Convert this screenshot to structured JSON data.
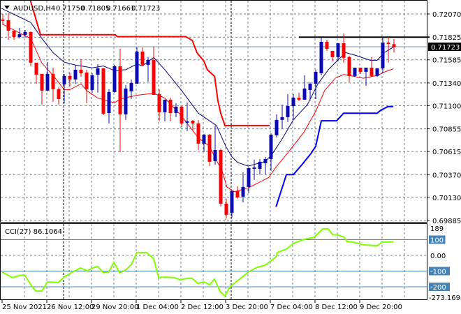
{
  "header": {
    "symbol": "AUDUSD,H4",
    "open": "0.71750",
    "high": "0.71805",
    "low": "0.71661",
    "close": "0.71723"
  },
  "colors": {
    "bull": "#0a0ab4",
    "bear": "#ff0000",
    "ma_fast": "#000080",
    "ma_slow": "#ff0000",
    "stop_up": "#ff0000",
    "stop_down": "#0000ff",
    "cci": "#7fff00",
    "level": "#4682b4",
    "grid": "#708090"
  },
  "chart_data": [
    {
      "type": "candlestick",
      "title": "AUDUSD,H4",
      "ylim": [
        0.69885,
        0.7207
      ],
      "y_ticks": [
        "0.72070",
        "0.71825",
        "0.71585",
        "0.71340",
        "0.71100",
        "0.70855",
        "0.70615",
        "0.70370",
        "0.70130",
        "0.69885"
      ],
      "current_price": "0.71723",
      "resistance_level": 0.71825,
      "x_labels": [
        "25 Nov 2021",
        "26 Nov 12:00",
        "29 Nov 20:00",
        "1 Dec 04:00",
        "2 Dec 12:00",
        "3 Dec 20:00",
        "7 Dec 04:00",
        "8 Dec 12:00",
        "9 Dec 20:00"
      ],
      "ohlc": [
        [
          0.72011,
          0.7207,
          0.71952,
          0.71997
        ],
        [
          0.72004,
          0.72078,
          0.71797,
          0.71893
        ],
        [
          0.71893,
          0.71893,
          0.71797,
          0.71827
        ],
        [
          0.71827,
          0.71923,
          0.71812,
          0.71856
        ],
        [
          0.71849,
          0.71901,
          0.71819,
          0.71879
        ],
        [
          0.71879,
          0.71886,
          0.71517,
          0.71554
        ],
        [
          0.71554,
          0.71554,
          0.71332,
          0.71428
        ],
        [
          0.71436,
          0.71436,
          0.71111,
          0.71259
        ],
        [
          0.71259,
          0.71561,
          0.71251,
          0.71436
        ],
        [
          0.71436,
          0.71502,
          0.71141,
          0.71274
        ],
        [
          0.71274,
          0.71296,
          0.71111,
          0.7117
        ],
        [
          0.71325,
          0.71436,
          0.71126,
          0.71414
        ],
        [
          0.71414,
          0.7145,
          0.71303,
          0.71377
        ],
        [
          0.71377,
          0.71532,
          0.71332,
          0.7148
        ],
        [
          0.7148,
          0.71591,
          0.71406,
          0.71443
        ],
        [
          0.7145,
          0.7148,
          0.71126,
          0.71274
        ],
        [
          0.71266,
          0.71443,
          0.71237,
          0.71421
        ],
        [
          0.71428,
          0.71539,
          0.71237,
          0.71495
        ],
        [
          0.71495,
          0.71495,
          0.71,
          0.71015
        ],
        [
          0.71022,
          0.71274,
          0.70912,
          0.71244
        ],
        [
          0.71244,
          0.71532,
          0.71237,
          0.71517
        ],
        [
          0.71517,
          0.71701,
          0.70609,
          0.71008
        ],
        [
          0.71008,
          0.71318,
          0.70949,
          0.71281
        ],
        [
          0.71251,
          0.71377,
          0.7117,
          0.7134
        ],
        [
          0.71332,
          0.71716,
          0.71332,
          0.71672
        ],
        [
          0.71672,
          0.71716,
          0.71517,
          0.71532
        ],
        [
          0.71532,
          0.71613,
          0.71355,
          0.71583
        ],
        [
          0.71583,
          0.71724,
          0.71214,
          0.71214
        ],
        [
          0.71222,
          0.71274,
          0.70934,
          0.7103
        ],
        [
          0.7103,
          0.71163,
          0.70934,
          0.71163
        ],
        [
          0.71163,
          0.71185,
          0.70934,
          0.71022
        ],
        [
          0.71022,
          0.71126,
          0.70978,
          0.71089
        ],
        [
          0.71089,
          0.71096,
          0.70875,
          0.70912
        ],
        [
          0.70919,
          0.71133,
          0.70831,
          0.70934
        ],
        [
          0.70941,
          0.70949,
          0.70838,
          0.70912
        ],
        [
          0.70912,
          0.70949,
          0.70631,
          0.70698
        ],
        [
          0.70698,
          0.70801,
          0.70609,
          0.70793
        ],
        [
          0.70793,
          0.70801,
          0.70462,
          0.70506
        ],
        [
          0.70513,
          0.7089,
          0.70476,
          0.70631
        ],
        [
          0.70631,
          0.70646,
          0.70034,
          0.70063
        ],
        [
          0.70063,
          0.70115,
          0.69908,
          0.69945
        ],
        [
          0.69967,
          0.70196,
          0.69916,
          0.70196
        ],
        [
          0.70196,
          0.70248,
          0.70115,
          0.7013
        ],
        [
          0.70137,
          0.70395,
          0.70078,
          0.7024
        ],
        [
          0.7024,
          0.70447,
          0.70174,
          0.7044
        ],
        [
          0.70432,
          0.70528,
          0.70314,
          0.70447
        ],
        [
          0.70432,
          0.70535,
          0.70373,
          0.70506
        ],
        [
          0.70491,
          0.70557,
          0.70373,
          0.70535
        ],
        [
          0.70535,
          0.70808,
          0.7041,
          0.70793
        ],
        [
          0.70786,
          0.71008,
          0.70764,
          0.70949
        ],
        [
          0.70949,
          0.71111,
          0.70853,
          0.70978
        ],
        [
          0.70978,
          0.71222,
          0.70927,
          0.71096
        ],
        [
          0.71096,
          0.71222,
          0.70963,
          0.71185
        ],
        [
          0.71185,
          0.71237,
          0.71148,
          0.71163
        ],
        [
          0.71163,
          0.71421,
          0.71163,
          0.71281
        ],
        [
          0.71266,
          0.71347,
          0.71155,
          0.71332
        ],
        [
          0.71332,
          0.7148,
          0.7117,
          0.71458
        ],
        [
          0.71443,
          0.71827,
          0.71421,
          0.71775
        ],
        [
          0.71775,
          0.71797,
          0.71679,
          0.71701
        ],
        [
          0.71679,
          0.71679,
          0.71569,
          0.71613
        ],
        [
          0.71613,
          0.7176,
          0.71569,
          0.7176
        ],
        [
          0.7176,
          0.71864,
          0.71554,
          0.71606
        ],
        [
          0.71613,
          0.71628,
          0.71347,
          0.71414
        ],
        [
          0.71414,
          0.71502,
          0.71406,
          0.71502
        ],
        [
          0.71502,
          0.71502,
          0.71436,
          0.71458
        ],
        [
          0.71458,
          0.71502,
          0.7131,
          0.71502
        ],
        [
          0.71502,
          0.71613,
          0.71406,
          0.71414
        ],
        [
          0.71414,
          0.71495,
          0.71406,
          0.71495
        ],
        [
          0.71495,
          0.71827,
          0.71443,
          0.71768
        ],
        [
          0.71768,
          0.71827,
          0.71554,
          0.71753
        ],
        [
          0.7175,
          0.71805,
          0.71661,
          0.71723
        ]
      ],
      "lines": [
        {
          "name": "ma_fast",
          "points": [
            [
              -0.25,
              0.7213
            ],
            [
              5,
              0.7198
            ],
            [
              7,
              0.7181
            ],
            [
              9,
              0.7166
            ],
            [
              11,
              0.7156
            ],
            [
              13,
              0.7153
            ],
            [
              16,
              0.715
            ],
            [
              18,
              0.7152
            ],
            [
              20,
              0.7147
            ],
            [
              22,
              0.7148
            ],
            [
              24,
              0.7154
            ],
            [
              25,
              0.7152
            ],
            [
              27,
              0.7161
            ],
            [
              29,
              0.7148
            ],
            [
              32,
              0.7126
            ],
            [
              35,
              0.7102
            ],
            [
              38.25,
              0.7089
            ],
            [
              39.9,
              0.7067
            ],
            [
              41,
              0.7056
            ],
            [
              42,
              0.705
            ],
            [
              43.9,
              0.7046
            ],
            [
              47,
              0.7051
            ],
            [
              48.25,
              0.7059
            ],
            [
              50.1,
              0.7076
            ],
            [
              52,
              0.7095
            ],
            [
              54.5,
              0.7111
            ],
            [
              56.4,
              0.7133
            ],
            [
              58.25,
              0.7148
            ],
            [
              60.1,
              0.7159
            ],
            [
              61.4,
              0.7166
            ],
            [
              63.25,
              0.7163
            ],
            [
              65.75,
              0.7158
            ],
            [
              67,
              0.7158
            ],
            [
              68.25,
              0.7166
            ],
            [
              69.9,
              0.7172
            ]
          ]
        },
        {
          "name": "ma_slow",
          "points": [
            [
              0,
              0.7196
            ],
            [
              5,
              0.7181
            ],
            [
              7,
              0.7155
            ],
            [
              9,
              0.7142
            ],
            [
              11,
              0.7127
            ],
            [
              12,
              0.7127
            ],
            [
              14,
              0.7133
            ],
            [
              15,
              0.7126
            ],
            [
              17,
              0.7118
            ],
            [
              20,
              0.7113
            ],
            [
              21,
              0.7117
            ],
            [
              24,
              0.7121
            ],
            [
              27,
              0.7123
            ],
            [
              29,
              0.7118
            ],
            [
              32,
              0.7099
            ],
            [
              35,
              0.7076
            ],
            [
              37,
              0.7067
            ],
            [
              38.25,
              0.7052
            ],
            [
              39.25,
              0.7041
            ],
            [
              40.1,
              0.7024
            ],
            [
              41.4,
              0.7019
            ],
            [
              43.9,
              0.7023
            ],
            [
              47.6,
              0.7034
            ],
            [
              48.9,
              0.7045
            ],
            [
              51.4,
              0.7063
            ],
            [
              53.9,
              0.7082
            ],
            [
              56,
              0.7104
            ],
            [
              57.6,
              0.7126
            ],
            [
              59.5,
              0.7139
            ],
            [
              61,
              0.7143
            ],
            [
              62,
              0.7142
            ],
            [
              64.5,
              0.7139
            ],
            [
              67,
              0.7142
            ],
            [
              68.5,
              0.7146
            ],
            [
              69.9,
              0.7149
            ]
          ]
        },
        {
          "name": "stop_up",
          "points": [
            [
              4.9,
              0.7222
            ],
            [
              6.75,
              0.7185
            ],
            [
              20.1,
              0.7185
            ],
            [
              20.5,
              0.7183
            ],
            [
              32.75,
              0.7183
            ],
            [
              33.9,
              0.7179
            ],
            [
              34.75,
              0.7166
            ],
            [
              36,
              0.7157
            ],
            [
              36.6,
              0.7148
            ],
            [
              37.9,
              0.7141
            ],
            [
              38.5,
              0.7115
            ],
            [
              39,
              0.7102
            ],
            [
              39.75,
              0.7089
            ],
            [
              47.75,
              0.7089
            ]
          ]
        },
        {
          "name": "stop_down",
          "points": [
            [
              48.9,
              0.7003
            ],
            [
              50.75,
              0.7037
            ],
            [
              52,
              0.7037
            ],
            [
              53.6,
              0.7048
            ],
            [
              55.1,
              0.7059
            ],
            [
              56,
              0.7067
            ],
            [
              57,
              0.7094
            ],
            [
              59.75,
              0.7094
            ],
            [
              61,
              0.7102
            ],
            [
              67,
              0.7102
            ],
            [
              67.6,
              0.7105
            ],
            [
              68.9,
              0.7109
            ],
            [
              69.9,
              0.7109
            ]
          ]
        }
      ]
    },
    {
      "type": "line",
      "title": "CCI(27) 86.1064",
      "ylim": [
        -273.1698,
        189
      ],
      "y_ticks": [
        "189",
        "100",
        "0.00",
        "-100",
        "-200",
        "-273.1698"
      ],
      "levels": [
        100,
        -100,
        -200
      ],
      "points": [
        [
          -0.1,
          -107
        ],
        [
          1.75,
          -142
        ],
        [
          2.9,
          -129
        ],
        [
          3.9,
          -124
        ],
        [
          5.1,
          -191
        ],
        [
          5.9,
          -227
        ],
        [
          7,
          -227
        ],
        [
          8,
          -169
        ],
        [
          9.9,
          -173
        ],
        [
          11,
          -138
        ],
        [
          12.4,
          -107
        ],
        [
          13.9,
          -80
        ],
        [
          15.1,
          -98
        ],
        [
          16.4,
          -76
        ],
        [
          17,
          -71
        ],
        [
          17.9,
          -107
        ],
        [
          18.9,
          -107
        ],
        [
          19.9,
          -44
        ],
        [
          20.9,
          -111
        ],
        [
          22,
          -93
        ],
        [
          23,
          -58
        ],
        [
          24,
          18
        ],
        [
          25.75,
          18
        ],
        [
          27,
          -22
        ],
        [
          27.9,
          -142
        ],
        [
          28.9,
          -138
        ],
        [
          30.75,
          -142
        ],
        [
          31.75,
          -156
        ],
        [
          32.9,
          -147
        ],
        [
          33.9,
          -147
        ],
        [
          34.9,
          -178
        ],
        [
          36,
          -169
        ],
        [
          37,
          -187
        ],
        [
          37.9,
          -151
        ],
        [
          38.9,
          -231
        ],
        [
          39.75,
          -258
        ],
        [
          40.75,
          -196
        ],
        [
          42.4,
          -151
        ],
        [
          43.9,
          -107
        ],
        [
          45.5,
          -76
        ],
        [
          47,
          -62
        ],
        [
          48.9,
          -9
        ],
        [
          49.1,
          18
        ],
        [
          50.75,
          40
        ],
        [
          52,
          76
        ],
        [
          53.9,
          102
        ],
        [
          55.75,
          116
        ],
        [
          57.25,
          169
        ],
        [
          58.25,
          169
        ],
        [
          59,
          133
        ],
        [
          60.1,
          129
        ],
        [
          61.1,
          116
        ],
        [
          61.6,
          89
        ],
        [
          62.75,
          84
        ],
        [
          64.5,
          67
        ],
        [
          67,
          62
        ],
        [
          67.9,
          84
        ],
        [
          69.9,
          86.1064
        ]
      ]
    }
  ]
}
